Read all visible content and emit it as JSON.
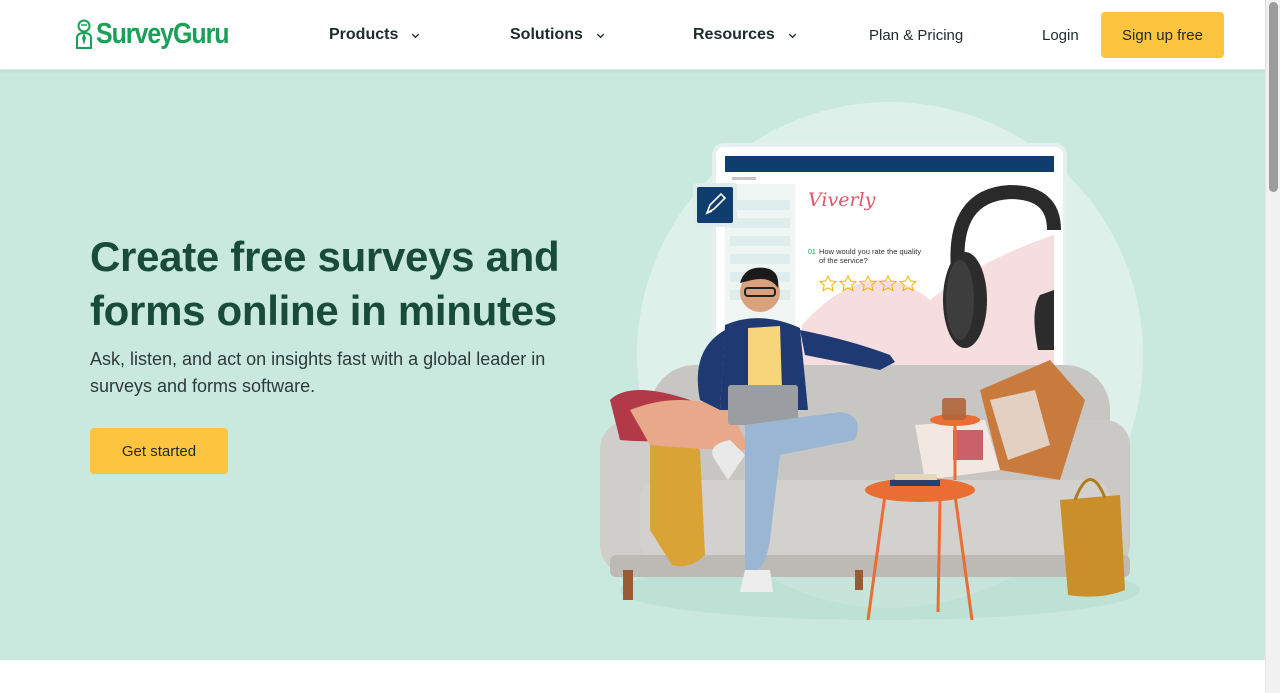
{
  "brand": {
    "name": "SurveyGuru",
    "color": "#1ba05a"
  },
  "nav": {
    "products": "Products",
    "solutions": "Solutions",
    "resources": "Resources",
    "pricing": "Plan & Pricing",
    "login": "Login",
    "signup": "Sign up free"
  },
  "hero": {
    "headline": "Create free surveys and forms online in minutes",
    "subhead": "Ask, listen, and act on insights fast with a global leader in surveys and forms software.",
    "cta": "Get started",
    "background": "#c9e8de",
    "accent": "#fdc53f"
  },
  "mockup": {
    "brand": "Viverly",
    "question_number": "01",
    "question_line1": "How would you rate the quality",
    "question_line2": "of the service?",
    "stars": 5
  },
  "icons": {
    "logo": "person-mascot-icon",
    "dropdown": "chevron-down-icon",
    "edit": "pen-edit-icon",
    "rating": "star-icon"
  }
}
